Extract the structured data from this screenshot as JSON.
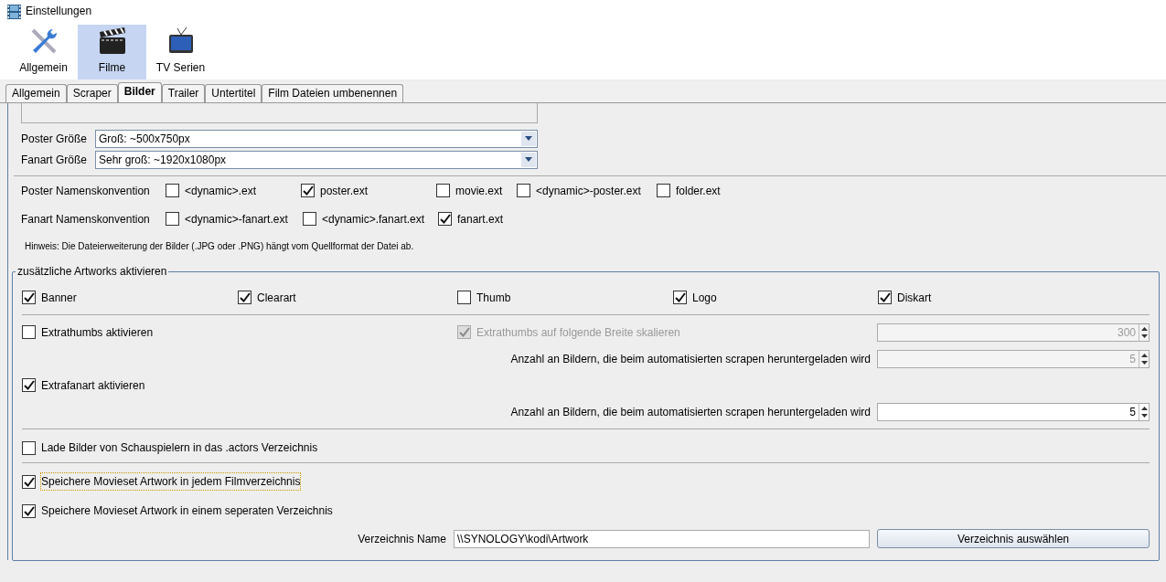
{
  "window": {
    "title": "Einstellungen"
  },
  "categories": [
    {
      "label": "Allgemein",
      "selected": false
    },
    {
      "label": "Filme",
      "selected": true
    },
    {
      "label": "TV Serien",
      "selected": false
    }
  ],
  "tabs": [
    {
      "label": "Allgemein",
      "selected": false
    },
    {
      "label": "Scraper",
      "selected": false
    },
    {
      "label": "Bilder",
      "selected": true
    },
    {
      "label": "Trailer",
      "selected": false
    },
    {
      "label": "Untertitel",
      "selected": false
    },
    {
      "label": "Film Dateien umbenennen",
      "selected": false
    }
  ],
  "size_fields": [
    {
      "label": "Poster Größe",
      "value": "Groß: ~500x750px"
    },
    {
      "label": "Fanart Größe",
      "value": "Sehr groß: ~1920x1080px"
    }
  ],
  "naming": [
    {
      "label": "Poster Namenskonvention",
      "options": [
        {
          "label": "<dynamic>.ext",
          "checked": false
        },
        {
          "label": "poster.ext",
          "checked": true
        },
        {
          "label": "movie.ext",
          "checked": false
        },
        {
          "label": "<dynamic>-poster.ext",
          "checked": false
        },
        {
          "label": "folder.ext",
          "checked": false
        }
      ]
    },
    {
      "label": "Fanart Namenskonvention",
      "options": [
        {
          "label": "<dynamic>-fanart.ext",
          "checked": false
        },
        {
          "label": "<dynamic>.fanart.ext",
          "checked": false
        },
        {
          "label": "fanart.ext",
          "checked": true
        }
      ]
    }
  ],
  "hint": "Hinweis: Die Dateierweiterung der Bilder (.JPG oder .PNG) hängt vom Quellformat der Datei ab.",
  "artwork_group": {
    "title": "zusätzliche Artworks aktivieren",
    "artworks": [
      {
        "label": "Banner",
        "checked": true
      },
      {
        "label": "Clearart",
        "checked": true
      },
      {
        "label": "Thumb",
        "checked": false
      },
      {
        "label": "Logo",
        "checked": true
      },
      {
        "label": "Diskart",
        "checked": true
      }
    ],
    "extrathumbs": {
      "label": "Extrathumbs aktivieren",
      "checked": false,
      "scale": {
        "label": "Extrathumbs auf folgende Breite skalieren",
        "checked": true,
        "disabled": true
      },
      "width": {
        "value": "300",
        "disabled": true
      },
      "count_label": "Anzahl an Bildern, die beim automatisierten scrapen heruntergeladen wird",
      "count": {
        "value": "5",
        "disabled": true
      }
    },
    "extrafanart": {
      "label": "Extrafanart aktivieren",
      "checked": true,
      "count_label": "Anzahl an Bildern, die beim automatisierten scrapen heruntergeladen wird",
      "count": {
        "value": "5",
        "disabled": false
      }
    },
    "actors": {
      "label": "Lade Bilder von Schauspielern in das .actors Verzeichnis",
      "checked": false
    },
    "movieset": [
      {
        "label": "Speichere Movieset Artwork in jedem Filmverzeichnis",
        "checked": true,
        "focused": true
      },
      {
        "label": "Speichere Movieset Artwork in einem seperaten Verzeichnis",
        "checked": true,
        "focused": false
      }
    ],
    "directory": {
      "label": "Verzeichnis Name",
      "value": "\\\\SYNOLOGY\\kodi\\Artwork",
      "button": "Verzeichnis auswählen"
    }
  }
}
